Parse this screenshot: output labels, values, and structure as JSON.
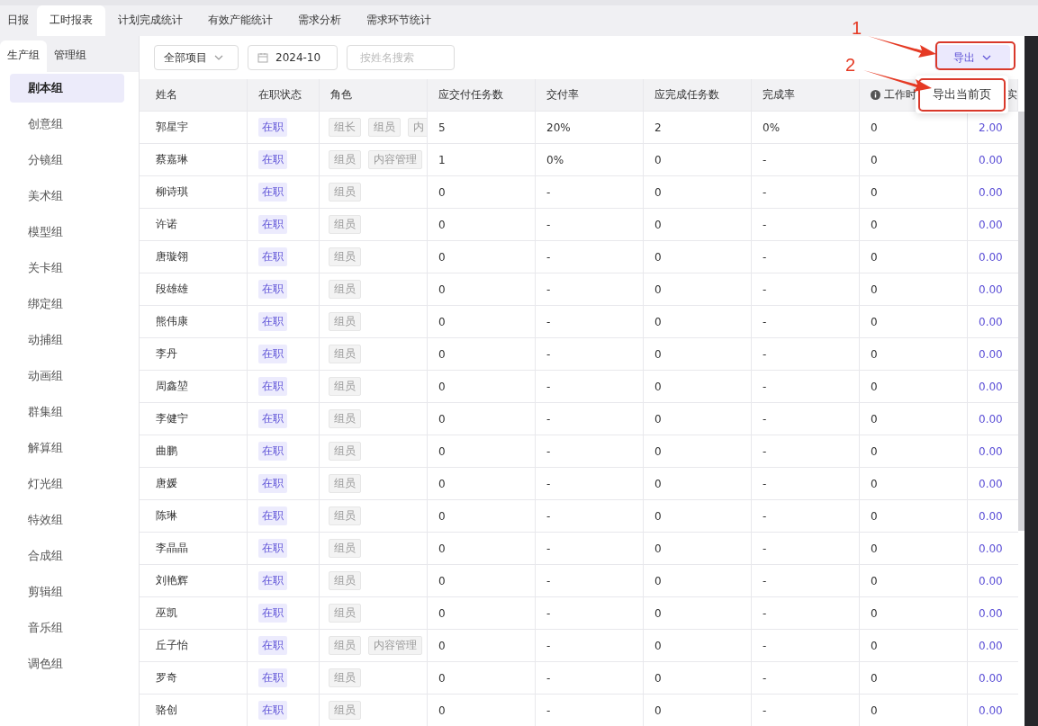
{
  "tabs": [
    {
      "label": "日报",
      "selected": false
    },
    {
      "label": "工时报表",
      "selected": true
    },
    {
      "label": "计划完成统计",
      "selected": false
    },
    {
      "label": "有效产能统计",
      "selected": false
    },
    {
      "label": "需求分析",
      "selected": false
    },
    {
      "label": "需求环节统计",
      "selected": false
    }
  ],
  "group_tabs": [
    {
      "label": "生产组",
      "selected": true
    },
    {
      "label": "管理组",
      "selected": false
    }
  ],
  "groups": [
    {
      "label": "剧本组",
      "selected": true
    },
    {
      "label": "创意组",
      "selected": false
    },
    {
      "label": "分镜组",
      "selected": false
    },
    {
      "label": "美术组",
      "selected": false
    },
    {
      "label": "模型组",
      "selected": false
    },
    {
      "label": "关卡组",
      "selected": false
    },
    {
      "label": "绑定组",
      "selected": false
    },
    {
      "label": "动捕组",
      "selected": false
    },
    {
      "label": "动画组",
      "selected": false
    },
    {
      "label": "群集组",
      "selected": false
    },
    {
      "label": "解算组",
      "selected": false
    },
    {
      "label": "灯光组",
      "selected": false
    },
    {
      "label": "特效组",
      "selected": false
    },
    {
      "label": "合成组",
      "selected": false
    },
    {
      "label": "剪辑组",
      "selected": false
    },
    {
      "label": "音乐组",
      "selected": false
    },
    {
      "label": "调色组",
      "selected": false
    }
  ],
  "toolbar": {
    "project_select": "全部项目",
    "month": "2024-10",
    "search": {
      "placeholder": "按姓名搜索"
    },
    "export_button": "导出"
  },
  "export_menu": {
    "items": [
      "导出当前页"
    ]
  },
  "table": {
    "columns": [
      {
        "label": "姓名",
        "info": false
      },
      {
        "label": "在职状态",
        "info": false
      },
      {
        "label": "角色",
        "info": false
      },
      {
        "label": "应交付任务数",
        "info": false
      },
      {
        "label": "交付率",
        "info": false
      },
      {
        "label": "应完成任务数",
        "info": false
      },
      {
        "label": "完成率",
        "info": false
      },
      {
        "label": "工作时",
        "info": true
      },
      {
        "label": "实",
        "info": false
      }
    ],
    "rows": [
      {
        "name": "郭星宇",
        "status": "在职",
        "roles": [
          "组长",
          "组员",
          "内"
        ],
        "delivery_tasks": "5",
        "delivery_rate": "20%",
        "completion_tasks": "2",
        "completion_rate": "0%",
        "work_hours": "0",
        "actual": "2.00"
      },
      {
        "name": "蔡嘉琳",
        "status": "在职",
        "roles": [
          "组员",
          "内容管理"
        ],
        "delivery_tasks": "1",
        "delivery_rate": "0%",
        "completion_tasks": "0",
        "completion_rate": "-",
        "work_hours": "0",
        "actual": "0.00"
      },
      {
        "name": "柳诗琪",
        "status": "在职",
        "roles": [
          "组员"
        ],
        "delivery_tasks": "0",
        "delivery_rate": "-",
        "completion_tasks": "0",
        "completion_rate": "-",
        "work_hours": "0",
        "actual": "0.00"
      },
      {
        "name": "许诺",
        "status": "在职",
        "roles": [
          "组员"
        ],
        "delivery_tasks": "0",
        "delivery_rate": "-",
        "completion_tasks": "0",
        "completion_rate": "-",
        "work_hours": "0",
        "actual": "0.00"
      },
      {
        "name": "唐璇翎",
        "status": "在职",
        "roles": [
          "组员"
        ],
        "delivery_tasks": "0",
        "delivery_rate": "-",
        "completion_tasks": "0",
        "completion_rate": "-",
        "work_hours": "0",
        "actual": "0.00"
      },
      {
        "name": "段雄雄",
        "status": "在职",
        "roles": [
          "组员"
        ],
        "delivery_tasks": "0",
        "delivery_rate": "-",
        "completion_tasks": "0",
        "completion_rate": "-",
        "work_hours": "0",
        "actual": "0.00"
      },
      {
        "name": "熊伟康",
        "status": "在职",
        "roles": [
          "组员"
        ],
        "delivery_tasks": "0",
        "delivery_rate": "-",
        "completion_tasks": "0",
        "completion_rate": "-",
        "work_hours": "0",
        "actual": "0.00"
      },
      {
        "name": "李丹",
        "status": "在职",
        "roles": [
          "组员"
        ],
        "delivery_tasks": "0",
        "delivery_rate": "-",
        "completion_tasks": "0",
        "completion_rate": "-",
        "work_hours": "0",
        "actual": "0.00"
      },
      {
        "name": "周鑫堃",
        "status": "在职",
        "roles": [
          "组员"
        ],
        "delivery_tasks": "0",
        "delivery_rate": "-",
        "completion_tasks": "0",
        "completion_rate": "-",
        "work_hours": "0",
        "actual": "0.00"
      },
      {
        "name": "李健宁",
        "status": "在职",
        "roles": [
          "组员"
        ],
        "delivery_tasks": "0",
        "delivery_rate": "-",
        "completion_tasks": "0",
        "completion_rate": "-",
        "work_hours": "0",
        "actual": "0.00"
      },
      {
        "name": "曲鹏",
        "status": "在职",
        "roles": [
          "组员"
        ],
        "delivery_tasks": "0",
        "delivery_rate": "-",
        "completion_tasks": "0",
        "completion_rate": "-",
        "work_hours": "0",
        "actual": "0.00"
      },
      {
        "name": "唐媛",
        "status": "在职",
        "roles": [
          "组员"
        ],
        "delivery_tasks": "0",
        "delivery_rate": "-",
        "completion_tasks": "0",
        "completion_rate": "-",
        "work_hours": "0",
        "actual": "0.00"
      },
      {
        "name": "陈琳",
        "status": "在职",
        "roles": [
          "组员"
        ],
        "delivery_tasks": "0",
        "delivery_rate": "-",
        "completion_tasks": "0",
        "completion_rate": "-",
        "work_hours": "0",
        "actual": "0.00"
      },
      {
        "name": "李晶晶",
        "status": "在职",
        "roles": [
          "组员"
        ],
        "delivery_tasks": "0",
        "delivery_rate": "-",
        "completion_tasks": "0",
        "completion_rate": "-",
        "work_hours": "0",
        "actual": "0.00"
      },
      {
        "name": "刘艳辉",
        "status": "在职",
        "roles": [
          "组员"
        ],
        "delivery_tasks": "0",
        "delivery_rate": "-",
        "completion_tasks": "0",
        "completion_rate": "-",
        "work_hours": "0",
        "actual": "0.00"
      },
      {
        "name": "巫凯",
        "status": "在职",
        "roles": [
          "组员"
        ],
        "delivery_tasks": "0",
        "delivery_rate": "-",
        "completion_tasks": "0",
        "completion_rate": "-",
        "work_hours": "0",
        "actual": "0.00"
      },
      {
        "name": "丘子怡",
        "status": "在职",
        "roles": [
          "组员",
          "内容管理"
        ],
        "delivery_tasks": "0",
        "delivery_rate": "-",
        "completion_tasks": "0",
        "completion_rate": "-",
        "work_hours": "0",
        "actual": "0.00"
      },
      {
        "name": "罗奇",
        "status": "在职",
        "roles": [
          "组员"
        ],
        "delivery_tasks": "0",
        "delivery_rate": "-",
        "completion_tasks": "0",
        "completion_rate": "-",
        "work_hours": "0",
        "actual": "0.00"
      },
      {
        "name": "骆创",
        "status": "在职",
        "roles": [
          "组员"
        ],
        "delivery_tasks": "0",
        "delivery_rate": "-",
        "completion_tasks": "0",
        "completion_rate": "-",
        "work_hours": "0",
        "actual": "0.00"
      }
    ]
  },
  "annotations": [
    {
      "label": "1"
    },
    {
      "label": "2"
    }
  ]
}
